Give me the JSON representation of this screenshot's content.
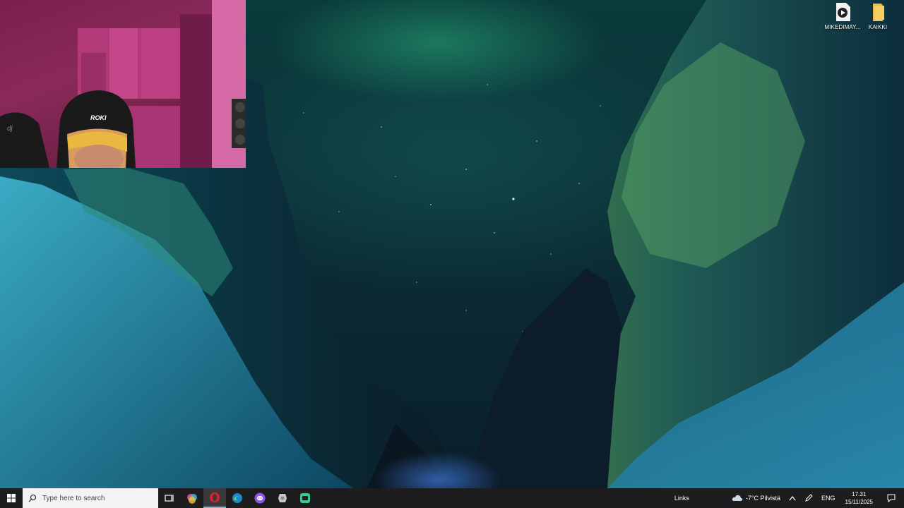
{
  "desktop": {
    "icons": [
      {
        "label": "MIKEDIMAY...",
        "icon": "video-file-icon"
      },
      {
        "label": "KAIKKI",
        "icon": "folder-icon"
      }
    ]
  },
  "webcam": {
    "cap_text": "ROKI",
    "chair_logo": "dj"
  },
  "taskbar": {
    "search_placeholder": "Type here to search",
    "apps": [
      {
        "name": "task-view-icon"
      },
      {
        "name": "color-app-icon"
      },
      {
        "name": "opera-icon"
      },
      {
        "name": "edge-icon"
      },
      {
        "name": "discord-icon"
      },
      {
        "name": "settings-app-icon"
      },
      {
        "name": "green-app-icon"
      }
    ],
    "links_label": "Links",
    "weather": "-7°C Pilvistä",
    "language": "ENG",
    "time": "17.31",
    "date": "15/11/2025"
  },
  "colors": {
    "taskbar": "#1d1d1f",
    "search_bg": "#f3f3f3",
    "accent": "#9ab"
  }
}
